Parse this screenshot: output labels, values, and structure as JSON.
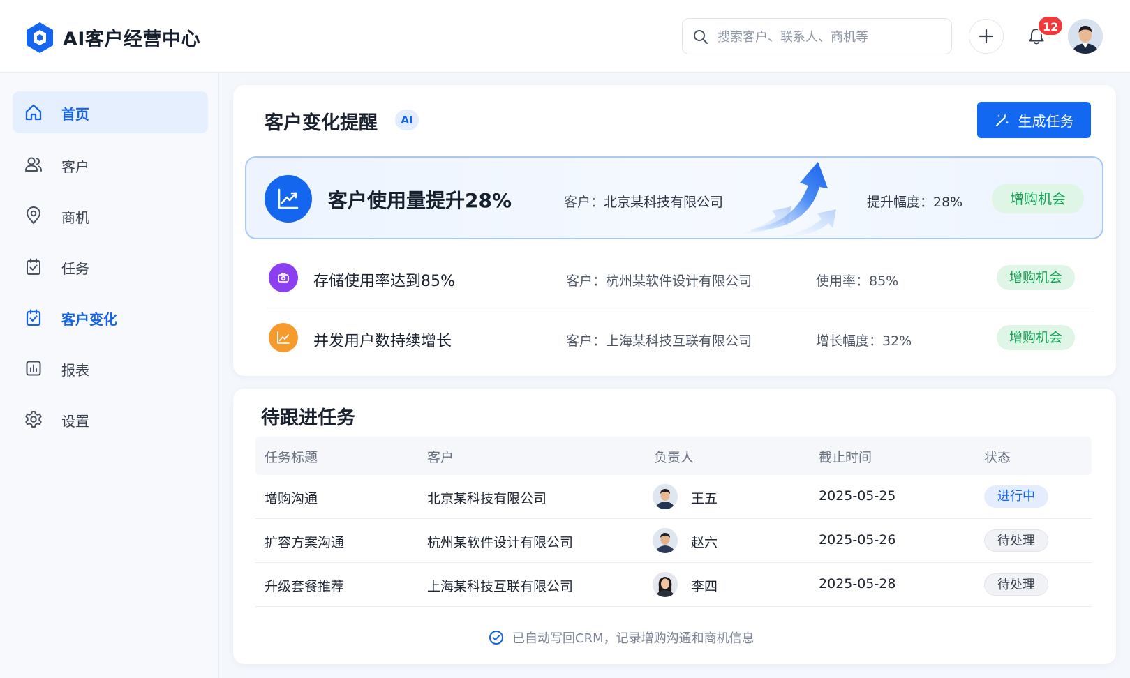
{
  "header": {
    "app_title": "AI客户经营中心",
    "search_placeholder": "搜索客户、联系人、商机等",
    "notification_count": "12"
  },
  "sidebar": {
    "items": [
      {
        "label": "首页",
        "icon": "home-icon"
      },
      {
        "label": "客户",
        "icon": "users-icon"
      },
      {
        "label": "商机",
        "icon": "location-pin-icon"
      },
      {
        "label": "任务",
        "icon": "clipboard-check-icon"
      },
      {
        "label": "客户变化",
        "icon": "calendar-check-icon"
      },
      {
        "label": "报表",
        "icon": "bar-chart-icon"
      },
      {
        "label": "设置",
        "icon": "gear-icon"
      }
    ]
  },
  "changes": {
    "title": "客户变化提醒",
    "ai_tag": "AI",
    "generate_button": "生成任务",
    "highlight": {
      "title": "客户使用量提升28%",
      "customer_key": "客户：",
      "customer": "北京某科技有限公司",
      "metric": "提升幅度：28%",
      "tag": "增购机会"
    },
    "alerts": [
      {
        "title": "存储使用率达到85%",
        "customer": "客户：杭州某软件设计有限公司",
        "metric": "使用率：85%",
        "tag": "增购机会"
      },
      {
        "title": "并发用户数持续增长",
        "customer": "客户：上海某科技互联有限公司",
        "metric": "增长幅度：32%",
        "tag": "增购机会"
      }
    ]
  },
  "tasks": {
    "title": "待跟进任务",
    "columns": [
      "任务标题",
      "客户",
      "负责人",
      "截止时间",
      "状态"
    ],
    "rows": [
      {
        "title": "增购沟通",
        "customer": "北京某科技有限公司",
        "owner": "王五",
        "due": "2025-05-25",
        "status": "进行中"
      },
      {
        "title": "扩容方案沟通",
        "customer": "杭州某软件设计有限公司",
        "owner": "赵六",
        "due": "2025-05-26",
        "status": "待处理"
      },
      {
        "title": "升级套餐推荐",
        "customer": "上海某科技互联有限公司",
        "owner": "李四",
        "due": "2025-05-28",
        "status": "待处理"
      }
    ],
    "footer_note": "已自动写回CRM，记录增购沟通和商机信息"
  },
  "colors": {
    "accent": "#1268f0",
    "opportunity_green": "#13a254",
    "alert_purple": "#8b3ff0",
    "alert_orange": "#f79a2c"
  }
}
